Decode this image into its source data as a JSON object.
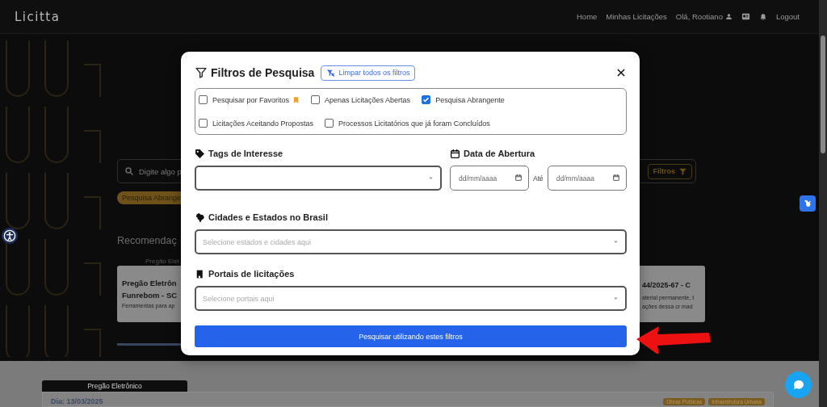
{
  "navbar": {
    "logo": "Licitta",
    "links": [
      "Home",
      "Minhas Licitações"
    ],
    "user": "Olá, Rootiano",
    "logout": "Logout"
  },
  "background": {
    "search": {
      "placeholder": "Digite algo p",
      "filters_button": "Filtros"
    },
    "active_filter": "Pesquisa Abrange",
    "section_title": "Recomendaç",
    "cards": [
      {
        "category": "Pregão Elet",
        "title_lines": [
          "Pregão Eletrôn",
          "Funrebom - SC"
        ],
        "description_lines": [
          "Ferramentas para ap"
        ]
      },
      {
        "title_lines": [
          "44/2025-67 - C"
        ],
        "description_lines": [
          "aterial permanente, t",
          "ações dessa cr mad"
        ]
      }
    ],
    "listing": {
      "tab": "Pregão Eletrônico",
      "date": "Dia: 13/03/2025",
      "tags": [
        "Obras Públicas",
        "Infraestrutura Urbana"
      ]
    }
  },
  "modal": {
    "title": "Filtros de Pesquisa",
    "clear_button": "Limpar todos os filtros",
    "options": [
      [
        {
          "label": "Pesquisar por Favoritos",
          "kind": "favorites",
          "checked": false
        },
        {
          "label": "Apenas Licitações Abertas",
          "kind": "plain",
          "checked": false
        },
        {
          "label": "Pesquisa Abrangente",
          "kind": "plain",
          "checked": true
        }
      ],
      [
        {
          "label": "Licitações Aceitando Propostas",
          "kind": "plain",
          "checked": false
        },
        {
          "label": "Processos Licitatórios que já foram Concluídos",
          "kind": "plain",
          "checked": false
        }
      ]
    ],
    "tags": {
      "label": "Tags de Interesse"
    },
    "date": {
      "label": "Data de Abertura",
      "from_placeholder": "dd/mm/aaaa",
      "separator": "Até",
      "to_placeholder": "dd/mm/aaaa"
    },
    "cities": {
      "label": "Cidades e Estados no Brasil",
      "placeholder": "Selecione estados e cidades aqui"
    },
    "portals": {
      "label": "Portais de licitações",
      "placeholder": "Selecione portais aqui"
    },
    "submit": "Pesquisar utilizando estes filtros"
  }
}
